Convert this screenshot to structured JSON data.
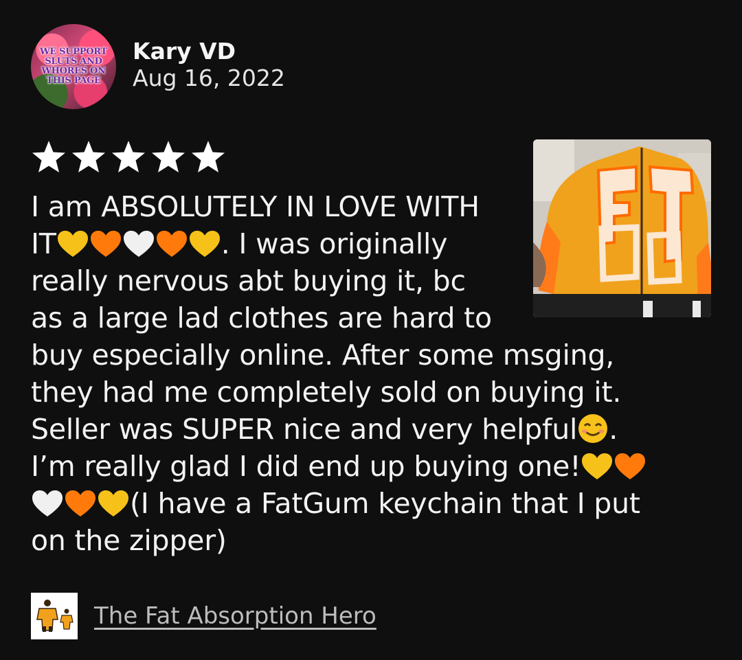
{
  "reviewer": {
    "name": "Kary VD",
    "date": "Aug 16, 2022",
    "avatar_text": "WE SUPPORT SLUTS AND WHORES ON THIS PAGE",
    "avatar_icon": "avatar-image"
  },
  "rating": {
    "value": 5,
    "max": 5,
    "color": "#ffffff"
  },
  "review": {
    "line1": "I am ABSOLUTELY IN LOVE WITH",
    "line2_a": "IT",
    "line2_b": ". I was originally",
    "line3": "really nervous abt buying it, bc",
    "line4": "as a large lad clothes are hard to",
    "line5": "buy especially online. After some msging,",
    "line6": "they had me completely sold on buying it.",
    "line7_a": "Seller was SUPER nice and very helpful",
    "line7_b": ".",
    "line8": "I’m really glad I did end up buying one!",
    "line9": "(I have a FatGum keychain that I put",
    "line10": "on the zipper)",
    "emoji_colors": {
      "yellow_heart": "#f6c21a",
      "orange_heart": "#ff7a0a",
      "white_heart": "#f0f0f0"
    }
  },
  "review_photo": {
    "icon": "review-photo-image",
    "jacket_color": "#f0a21c",
    "accent_color": "#ff6a00"
  },
  "product": {
    "title": "The Fat Absorption Hero",
    "thumb_icon": "product-thumbnail"
  },
  "colors": {
    "background": "#0f0f0f",
    "text": "#f3f3f3",
    "link": "#bdbdbd"
  }
}
